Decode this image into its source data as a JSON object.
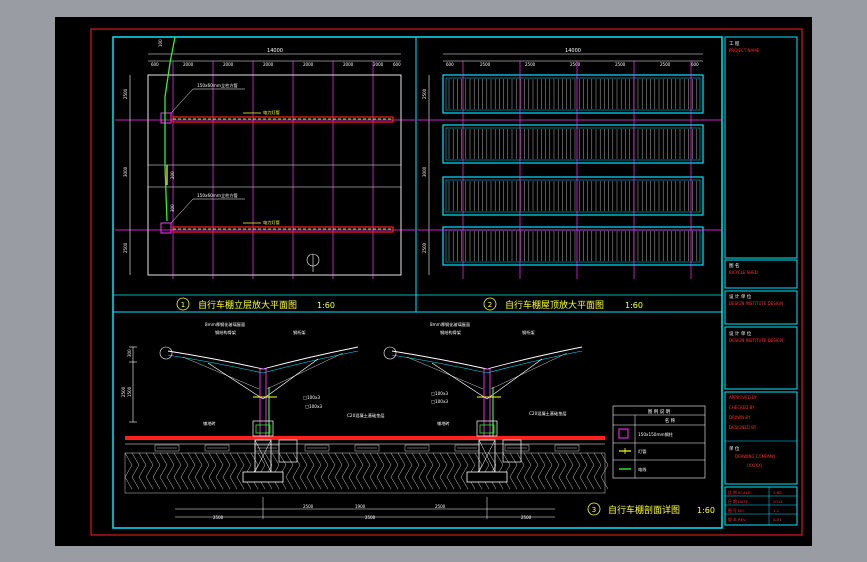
{
  "drawing": {
    "plan1": {
      "number": "1",
      "title": "自行车棚立层放大平面图",
      "scale": "1:60",
      "overall_dim": "14000",
      "bay_dims": [
        "600",
        "2000",
        "2000",
        "2000",
        "2000",
        "2000",
        "2000",
        "600"
      ],
      "side_dims": [
        "2500",
        "3000",
        "2500"
      ],
      "annotation_pipe": "150x60mm立柱方管",
      "annotation_lamp": "电力灯管",
      "small_dims": [
        "100",
        "200",
        "300"
      ]
    },
    "plan2": {
      "number": "2",
      "title": "自行车棚屋顶放大平面图",
      "scale": "1:60",
      "overall_dim": "14000",
      "bay_dims": [
        "600",
        "2500",
        "2500",
        "2500",
        "2500",
        "2500",
        "600"
      ],
      "side_dims": [
        "2500",
        "3000",
        "2500"
      ]
    },
    "section3": {
      "number": "3",
      "title": "自行车棚剖面详图",
      "scale": "1:60",
      "top_notes": [
        "8mm厚钢化玻璃屋面",
        "钢结构骨架",
        "钢桁架"
      ],
      "notes_mid": [
        "□100x3",
        "□100x3",
        "C20混凝土基础垫层"
      ],
      "ground_label": "铺地砖",
      "left_dims": [
        "300",
        "1500",
        "2500"
      ],
      "bottom_dims": [
        "2500",
        "2500",
        "1900",
        "2500",
        "2500"
      ],
      "bottom_total": "1900",
      "bottom_total_b": "2500"
    },
    "legend": {
      "title": "图 例 说 明",
      "header": "名 称",
      "rows": [
        {
          "icon": "column-square-icon",
          "label": "150x150mm钢柱"
        },
        {
          "icon": "light-line-icon",
          "label": "灯管"
        },
        {
          "icon": "green-line-icon",
          "label": "电线"
        }
      ]
    }
  },
  "titleblock": {
    "project_label": "工 程",
    "project_value": "PROJECT NAME",
    "drawing_label": "图 名",
    "drawing_value": "BICYCLE SHED",
    "design_label": "设 计 单 位",
    "design_value": "DESIGN INSTITUTE DESIGN",
    "sign_rows": [
      "APPROVED BY",
      "CHECKED BY",
      "DRAWN BY",
      "DESIGNED BY"
    ],
    "company_label": "单 位",
    "company_value": "DRAWING COMPANY",
    "company_sub": "(XX/XX)",
    "info_rows": [
      {
        "k": "比 例 SCALE",
        "v": "1:60"
      },
      {
        "k": "日 期 DATE",
        "v": "2014"
      },
      {
        "k": "图 号 NO.",
        "v": "1-1"
      },
      {
        "k": "版 本 REV.",
        "v": "A-01"
      }
    ]
  },
  "colors": {
    "sheet_bg": "#000000",
    "cyan": "#00e5ff",
    "yellow": "#ffff33",
    "magenta": "#ff33ff",
    "red": "#ff2020",
    "green": "#33ee33",
    "white": "#ffffff"
  }
}
